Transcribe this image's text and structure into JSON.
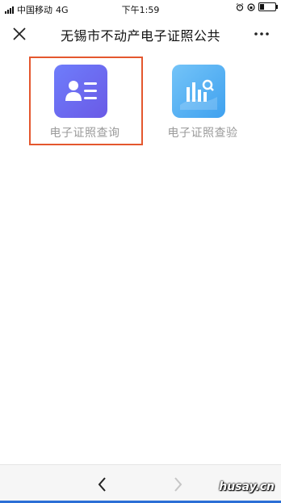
{
  "status_bar": {
    "carrier": "中国移动",
    "network": "4G",
    "time": "下午1:59"
  },
  "nav": {
    "title": "无锡市不动产电子证照公共",
    "close_icon": "close-icon",
    "more_icon": "more-icon"
  },
  "tiles": [
    {
      "label": "电子证照查询",
      "icon": "id-card-icon",
      "color": "#6a6cf0"
    },
    {
      "label": "电子证照查验",
      "icon": "chart-search-icon",
      "color": "#4aa9f2"
    }
  ],
  "highlight_color": "#e4572e",
  "bottom_bar": {
    "back_icon": "chevron-left-icon",
    "forward_icon": "chevron-right-icon",
    "watermark": "husay.cn"
  }
}
